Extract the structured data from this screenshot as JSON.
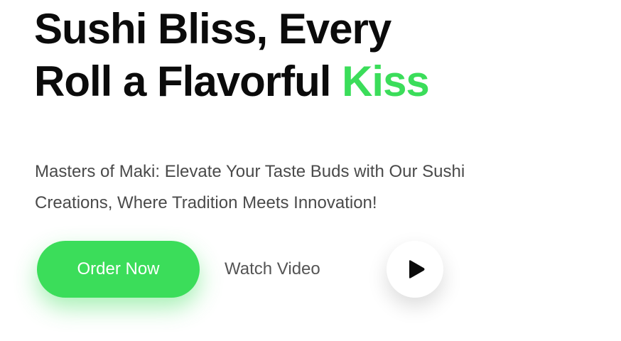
{
  "hero": {
    "headline_line1": "Sushi Bliss, Every",
    "headline_line2_prefix": "Roll a Flavorful ",
    "headline_accent": "Kiss",
    "subtitle_line1": "Masters of Maki: Elevate Your Taste Buds with Our Sushi",
    "subtitle_line2": "Creations, Where Tradition Meets Innovation!"
  },
  "actions": {
    "order_label": "Order Now",
    "watch_label": "Watch Video",
    "play_icon": "play-icon"
  },
  "colors": {
    "accent": "#3bdd5a",
    "headline": "#0b0b0b",
    "body_text": "#4a4a4a",
    "button_text": "#ffffff"
  }
}
